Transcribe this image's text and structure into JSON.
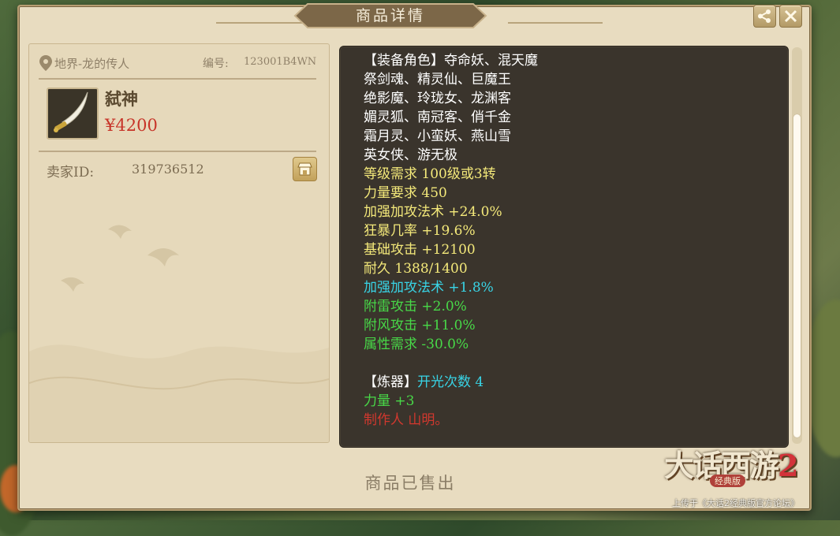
{
  "window": {
    "title": "商品详情"
  },
  "item": {
    "location": "地界-龙的传人",
    "serial_label": "编号:",
    "serial": "123001B4WN",
    "name": "弑神",
    "price": "¥4200",
    "seller_label": "卖家ID:",
    "seller_id": "319736512"
  },
  "details": [
    {
      "text": "【装备角色】夺命妖、混天魔",
      "color": "#ffffff"
    },
    {
      "text": "祭剑魂、精灵仙、巨魔王",
      "color": "#ffffff"
    },
    {
      "text": "绝影魔、玲珑女、龙渊客",
      "color": "#ffffff"
    },
    {
      "text": "媚灵狐、南冠客、俏千金",
      "color": "#ffffff"
    },
    {
      "text": "霜月灵、小蛮妖、燕山雪",
      "color": "#ffffff"
    },
    {
      "text": "英女侠、游无极",
      "color": "#ffffff"
    },
    {
      "text": "等级需求 100级或3转",
      "color": "#f4e97a"
    },
    {
      "text": "力量要求 450",
      "color": "#f4e97a"
    },
    {
      "text": "加强加攻法术 +24.0%",
      "color": "#f4e97a"
    },
    {
      "text": "狂暴几率 +19.6%",
      "color": "#f4e97a"
    },
    {
      "text": "基础攻击 +12100",
      "color": "#f4e97a"
    },
    {
      "text": "耐久 1388/1400",
      "color": "#f4e97a"
    },
    {
      "text": "加强加攻法术 +1.8%",
      "color": "#38d4e6"
    },
    {
      "text": "附雷攻击 +2.0%",
      "color": "#48d948"
    },
    {
      "text": "附风攻击 +11.0%",
      "color": "#48d948"
    },
    {
      "text": "属性需求 -30.0%",
      "color": "#48d948"
    },
    {
      "text": "",
      "color": "#ffffff"
    },
    {
      "text": "【炼器】",
      "color": "#ffffff",
      "tail": "开光次数 4",
      "tail_color": "#38d4e6"
    },
    {
      "text": "力量 +3",
      "color": "#48d948"
    },
    {
      "text": "制作人 山明。",
      "color": "#d2382e"
    }
  ],
  "footer": {
    "status": "商品已售出"
  },
  "watermark": {
    "title_main": "大话西游",
    "title_num": "2",
    "edition": "经典版",
    "credit": "上传于《大话2经典版官方论坛》"
  },
  "icons": [
    "share-icon",
    "close-icon",
    "location-pin-icon",
    "sword-item-icon",
    "shop-icon"
  ]
}
